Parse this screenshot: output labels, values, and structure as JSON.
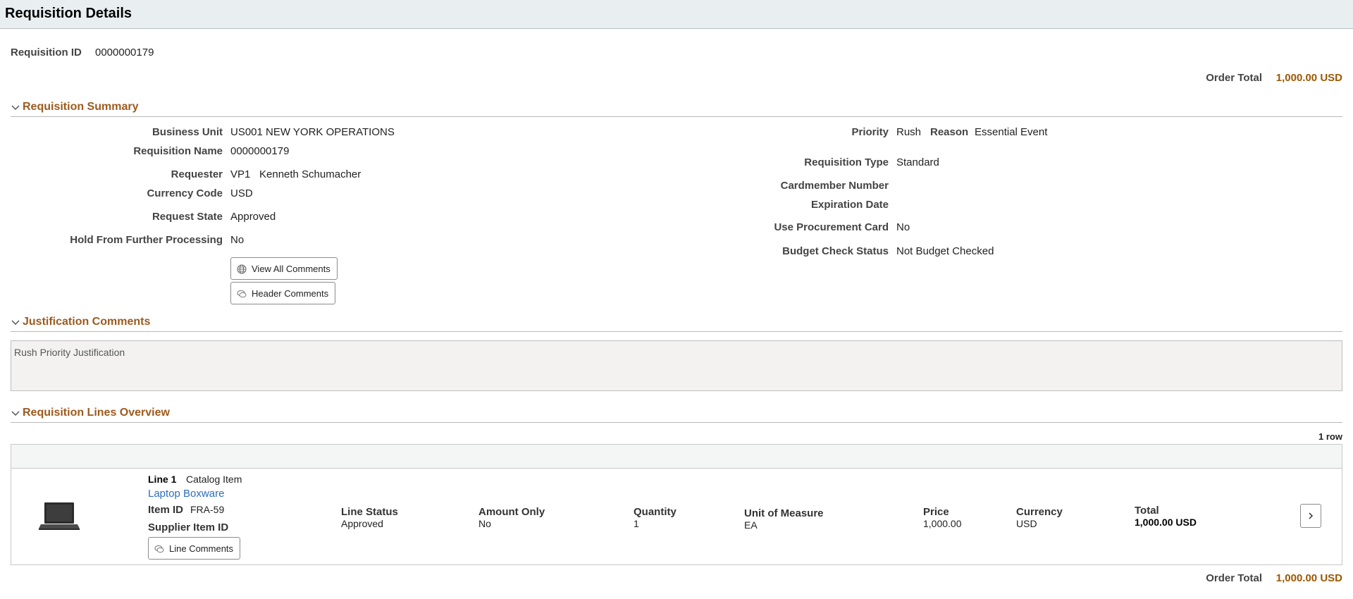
{
  "page": {
    "title": "Requisition Details"
  },
  "header": {
    "req_id_label": "Requisition ID",
    "req_id_value": "0000000179",
    "order_total_label": "Order Total",
    "order_total_value": "1,000.00 USD"
  },
  "summary": {
    "section_title": "Requisition Summary",
    "business_unit_label": "Business Unit",
    "business_unit_value": "US001 NEW YORK OPERATIONS",
    "req_name_label": "Requisition Name",
    "req_name_value": "0000000179",
    "requester_label": "Requester",
    "requester_id": "VP1",
    "requester_name": "Kenneth Schumacher",
    "currency_label": "Currency Code",
    "currency_value": "USD",
    "request_state_label": "Request State",
    "request_state_value": "Approved",
    "hold_label": "Hold From Further Processing",
    "hold_value": "No",
    "view_comments_btn": "View All Comments",
    "header_comments_btn": "Header Comments",
    "priority_label": "Priority",
    "priority_value": "Rush",
    "reason_label": "Reason",
    "reason_value": "Essential Event",
    "req_type_label": "Requisition Type",
    "req_type_value": "Standard",
    "cardmember_label": "Cardmember Number",
    "expiration_label": "Expiration Date",
    "proc_card_label": "Use Procurement Card",
    "proc_card_value": "No",
    "budget_label": "Budget Check Status",
    "budget_value": "Not Budget Checked"
  },
  "justification": {
    "section_title": "Justification Comments",
    "text": "Rush Priority Justification"
  },
  "lines": {
    "section_title": "Requisition Lines Overview",
    "row_count": "1 row",
    "line": {
      "line_label": "Line 1",
      "line_type": "Catalog Item",
      "item_desc": "Laptop Boxware",
      "item_id_label": "Item ID",
      "item_id_value": "FRA-59",
      "supplier_item_label": "Supplier Item ID",
      "line_comments_btn": "Line Comments",
      "status_label": "Line Status",
      "status_value": "Approved",
      "amount_only_label": "Amount Only",
      "amount_only_value": "No",
      "quantity_label": "Quantity",
      "quantity_value": "1",
      "uom_label": "Unit of Measure",
      "uom_value": "EA",
      "price_label": "Price",
      "price_value": "1,000.00",
      "currency_label": "Currency",
      "currency_value": "USD",
      "total_label": "Total",
      "total_value": "1,000.00 USD"
    }
  },
  "footer": {
    "order_total_label": "Order Total",
    "order_total_value": "1,000.00 USD"
  },
  "icons": {
    "collapse": "chevron-down-icon",
    "globe": "globe-icon",
    "comment": "comment-icon",
    "next": "chevron-right-icon",
    "laptop": "laptop-icon"
  },
  "colors": {
    "header_bg": "#e9eff1",
    "section_title": "#9c5a1f",
    "order_total": "#9c5700",
    "link": "#2a6ebb"
  }
}
